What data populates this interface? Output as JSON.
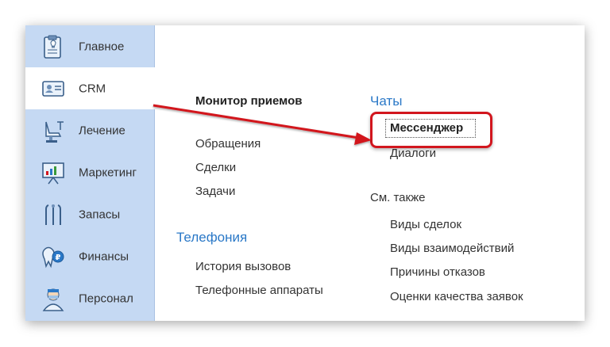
{
  "sidebar": {
    "items": [
      {
        "label": "Главное",
        "icon": "clipboard-tooth-icon"
      },
      {
        "label": "CRM",
        "icon": "contact-card-icon"
      },
      {
        "label": "Лечение",
        "icon": "dental-chair-icon"
      },
      {
        "label": "Маркетинг",
        "icon": "presentation-board-icon"
      },
      {
        "label": "Запасы",
        "icon": "dental-tools-icon"
      },
      {
        "label": "Финансы",
        "icon": "tooth-coin-icon"
      },
      {
        "label": "Персонал",
        "icon": "doctor-icon"
      }
    ]
  },
  "menu": {
    "col1": {
      "monitor": "Монитор приемов",
      "items": [
        "Обращения",
        "Сделки",
        "Задачи"
      ],
      "telephony_head": "Телефония",
      "telephony_items": [
        "История вызовов",
        "Телефонные аппараты"
      ]
    },
    "col2": {
      "chats_head": "Чаты",
      "messenger": "Мессенджер",
      "dialogs": "Диалоги",
      "see_also": "См. также",
      "see_items": [
        "Виды сделок",
        "Виды взаимодействий",
        "Причины отказов",
        "Оценки качества заявок"
      ]
    }
  },
  "colors": {
    "sidebar_bg": "#c5d9f3",
    "accent_blue": "#2a78c7",
    "annotation_red": "#d2161e"
  }
}
